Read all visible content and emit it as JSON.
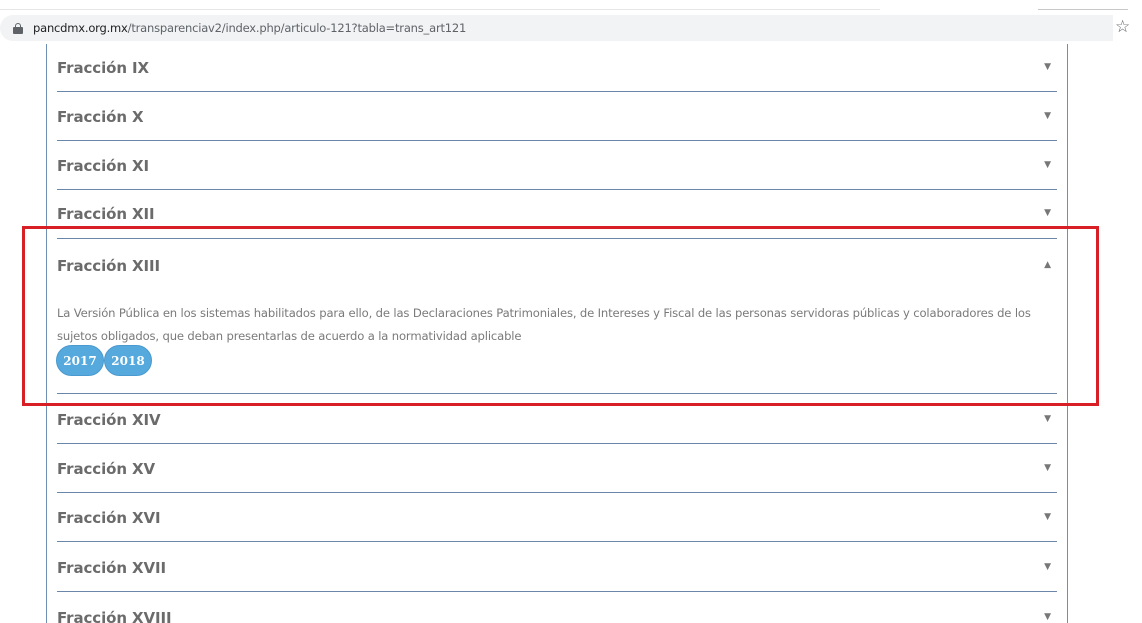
{
  "browser": {
    "url_host": "pancdmx.org.mx",
    "url_path": "/transparenciav2/index.php/articulo-121?tabla=trans_art121",
    "icons": {
      "lock": "lock-icon",
      "bookmark": "star-icon"
    }
  },
  "accordion": {
    "items": [
      {
        "title": "Fracción IX",
        "arrow": "▼"
      },
      {
        "title": "Fracción X",
        "arrow": "▼"
      },
      {
        "title": "Fracción XI",
        "arrow": "▼"
      },
      {
        "title": "Fracción XII",
        "arrow": "▼"
      },
      {
        "title": "Fracción XIII",
        "arrow": "▲",
        "expanded": true
      },
      {
        "title": "Fracción XIV",
        "arrow": "▼"
      },
      {
        "title": "Fracción XV",
        "arrow": "▼"
      },
      {
        "title": "Fracción XVI",
        "arrow": "▼"
      },
      {
        "title": "Fracción XVII",
        "arrow": "▼"
      },
      {
        "title": "Fracción XVIII",
        "arrow": "▼"
      }
    ],
    "expanded_description": "La Versión Pública en los sistemas habilitados para ello, de las Declaraciones Patrimoniales, de Intereses y Fiscal de las personas servidoras públicas y colaboradores de los sujetos obligados, que deban presentarlas de acuerdo a la normatividad aplicable",
    "year_buttons": [
      "2017",
      "2018"
    ]
  },
  "colors": {
    "highlight_border": "#d81f26",
    "year_button": "#56a9dc",
    "divider": "#6a86a8"
  }
}
